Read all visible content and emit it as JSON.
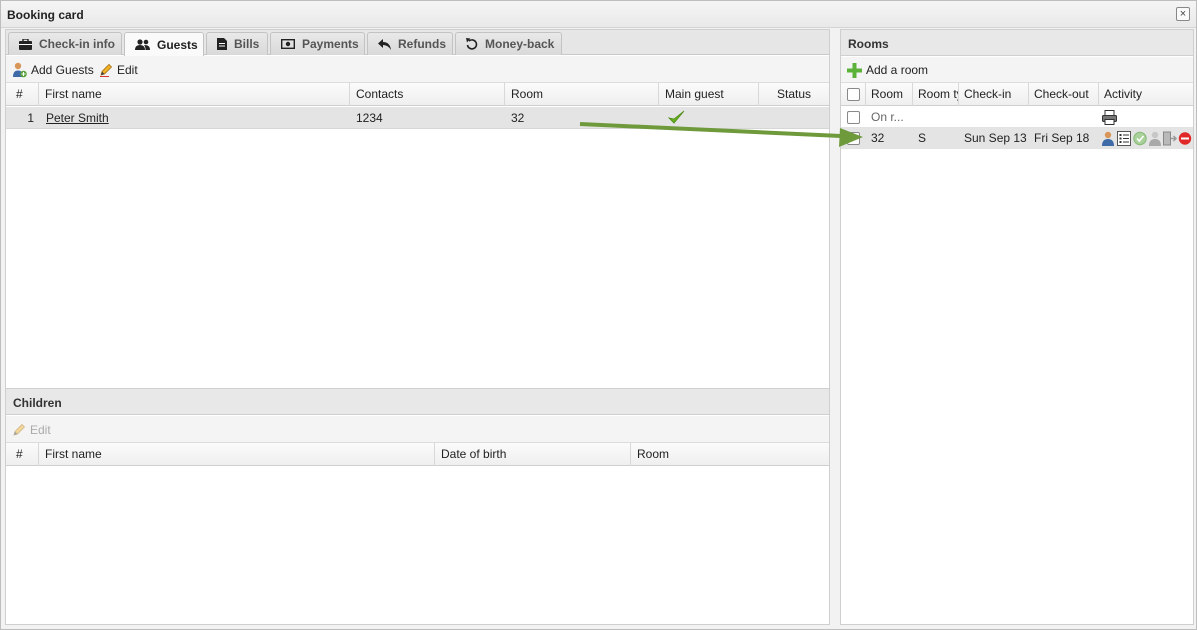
{
  "window": {
    "title": "Booking card"
  },
  "tabs": [
    {
      "label": "Check-in info",
      "icon": "briefcase-icon",
      "active": false
    },
    {
      "label": "Guests",
      "icon": "users-icon",
      "active": true
    },
    {
      "label": "Bills",
      "icon": "document-icon",
      "active": false
    },
    {
      "label": "Payments",
      "icon": "banknote-icon",
      "active": false
    },
    {
      "label": "Refunds",
      "icon": "reply-icon",
      "active": false
    },
    {
      "label": "Money-back",
      "icon": "undo-icon",
      "active": false
    }
  ],
  "guests": {
    "toolbar": {
      "add_label": "Add Guests",
      "edit_label": "Edit"
    },
    "columns": [
      "#",
      "First name",
      "Contacts",
      "Room",
      "Main guest",
      "Status"
    ],
    "rows": [
      {
        "num": "1",
        "first_name": "Peter Smith",
        "contacts": "1234",
        "room": "32",
        "main_guest": true,
        "status": ""
      }
    ]
  },
  "children": {
    "title": "Children",
    "toolbar": {
      "edit_label": "Edit"
    },
    "columns": [
      "#",
      "First name",
      "Date of birth",
      "Room"
    ],
    "rows": []
  },
  "rooms": {
    "title": "Rooms",
    "toolbar": {
      "add_label": "Add a room"
    },
    "columns": [
      "Room",
      "Room ty",
      "Check-in",
      "Check-out",
      "Activity"
    ],
    "rows": [
      {
        "room": "On r...",
        "room_type": "",
        "check_in": "",
        "check_out": "",
        "activity": [
          "printer-icon"
        ]
      },
      {
        "room": "32",
        "room_type": "S",
        "check_in": "Sun Sep 13",
        "check_out": "Fri Sep 18",
        "activity": [
          "guest-icon",
          "list-icon",
          "check-circle-icon",
          "guest-gray-icon",
          "door-exit-icon",
          "cancel-icon"
        ]
      }
    ]
  },
  "colors": {
    "accent_green": "#6f9a3c",
    "check_green": "#67b020",
    "cancel_red": "#e02828"
  }
}
